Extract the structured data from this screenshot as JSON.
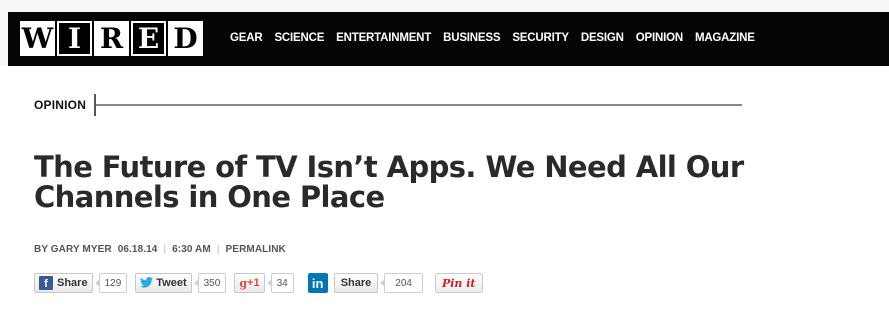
{
  "header": {
    "logo_letters": [
      "W",
      "I",
      "R",
      "E",
      "D"
    ],
    "nav": [
      "GEAR",
      "SCIENCE",
      "ENTERTAINMENT",
      "BUSINESS",
      "SECURITY",
      "DESIGN",
      "OPINION",
      "MAGAZINE"
    ]
  },
  "section": {
    "label": "OPINION"
  },
  "article": {
    "headline_line1": "The Future of TV Isn’t Apps. We Need All Our",
    "headline_line2": "Channels in One Place",
    "byline": {
      "author": "BY GARY MYER",
      "date": "06.18.14",
      "time": "6:30 AM",
      "permalink": "PERMALINK"
    }
  },
  "share": {
    "facebook": {
      "icon": "facebook-icon",
      "label": "Share",
      "count": "129"
    },
    "twitter": {
      "icon": "twitter-icon",
      "label": "Tweet",
      "count": "350"
    },
    "googleplus": {
      "icon": "googleplus-icon",
      "label": "+1",
      "count": "34"
    },
    "linkedin": {
      "icon": "linkedin-icon",
      "icon_text": "in",
      "label": "Share",
      "count": "204"
    },
    "pinterest": {
      "icon": "pinterest-icon",
      "label": "Pin it"
    }
  },
  "colors": {
    "nav_bg": "#050505",
    "facebook": "#3b5998",
    "twitter": "#29a9e1",
    "googleplus": "#dd4b39",
    "linkedin": "#0077b5",
    "pinterest": "#cb2027"
  }
}
